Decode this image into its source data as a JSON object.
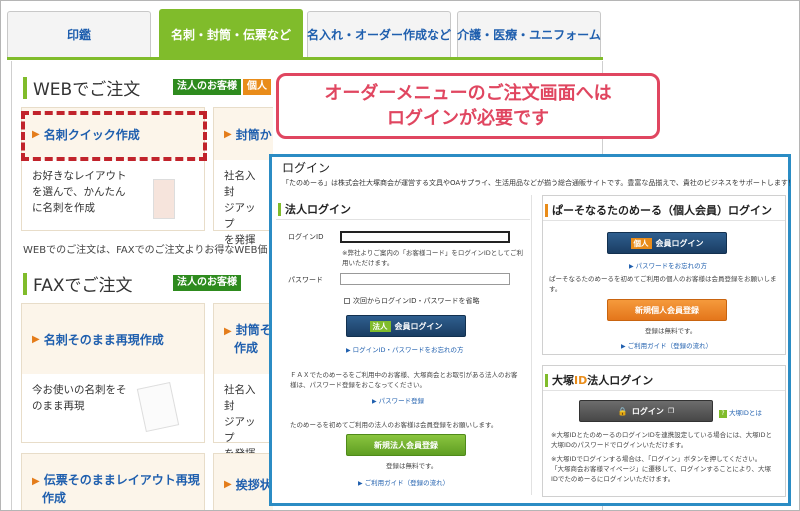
{
  "tabs": [
    {
      "label": "印鑑"
    },
    {
      "label": "名刺・封筒・伝票など"
    },
    {
      "label": "名入れ・オーダー作成など"
    },
    {
      "label": "介護・医療・ユニフォーム"
    }
  ],
  "web_section": {
    "title": "WEBでご注文",
    "badge_corp": "法人のお客様",
    "badge_indiv": "個人",
    "cards": [
      {
        "title": "名刺クイック作成",
        "desc_lines": [
          "お好きなレイアウト",
          "を選んで、かんたん",
          "に名刺を作成"
        ]
      },
      {
        "title": "封筒か",
        "desc_lines": [
          "社名入封",
          "ジアップ",
          "を発揮"
        ]
      }
    ],
    "note": "WEBでのご注文は、FAXでのご注文よりお得なWEB価"
  },
  "fax_section": {
    "title": "FAXでご注文",
    "badge_corp": "法人のお客様",
    "cards": [
      {
        "title": "名刺そのまま再現作成",
        "desc_lines": [
          "今お使いの名刺をそ",
          "のまま再現"
        ]
      },
      {
        "title_lines": [
          "封筒そ",
          "作成"
        ],
        "desc_lines": [
          "社名入封",
          "ジアップ",
          "を発揮"
        ]
      },
      {
        "title_lines": [
          "伝票そのままレイアウト再現",
          "作成"
        ]
      },
      {
        "title": "挨拶状"
      }
    ]
  },
  "callout": {
    "line1": "オーダーメニューのご注文画面へは",
    "line2": "ログインが必要です"
  },
  "login": {
    "title": "ログイン",
    "intro": "「たのめーる」は株式会社大塚商会が運営する文具やOAサプライ、生活用品などが揃う総合通販サイトです。豊富な品揃えで、貴社のビジネスをサポートします！",
    "corporate": {
      "heading": "法人ログイン",
      "id_label": "ログインID",
      "id_note_lines": [
        "※弊社よりご案内の「お客様コード」をログインIDとしてご利",
        "用いただけます。"
      ],
      "pw_label": "パスワード",
      "remember_label": "次回からログインID・パスワードを省略",
      "login_tag": "法人",
      "login_label": "会員ログイン",
      "forgot_link": "ログインID・パスワードをお忘れの方",
      "fax_note_lines": [
        "ＦＡＸでたのめーるをご利用中のお客様、大塚商会とお取引がある法人のお客",
        "様は、パスワード登録をおこなってください。"
      ],
      "pw_register_link": "パスワード登録",
      "first_note": "たのめーるを初めてご利用の法人のお客様は会員登録をお願いします。",
      "register_label": "新規法人会員登録",
      "free_note": "登録は無料です。",
      "guide_link": "ご利用ガイド（登録の流れ）"
    },
    "personal": {
      "heading": "ぱーそなるたのめーる（個人会員）ログイン",
      "login_tag": "個人",
      "login_label": "会員ログイン",
      "forgot_link": "パスワードをお忘れの方",
      "first_note": "ぱーそなるたのめーるを初めてご利用の個人のお客様は会員登録をお願いします。",
      "register_label": "新規個人会員登録",
      "free_note": "登録は無料です。",
      "guide_link": "ご利用ガイド（登録の流れ）"
    },
    "otsuka": {
      "heading_prefix": "大塚",
      "heading_id": "ID",
      "heading_suffix": " 法人ログイン",
      "login_label": "ログイン",
      "help_link": "大塚IDとは",
      "note1_lines": [
        "※大塚IDとたのめーるのログインIDを連携設定している場合には、大塚IDと",
        "大塚IDのパスワードでログインいただけます。"
      ],
      "note2_lines": [
        "※大塚IDでログインする場合は、「ログイン」ボタンを押してください。",
        "「大塚商会お客様マイページ」に遷移して、ログインすることにより、大塚",
        "IDでたのめーるにログインいただけます。"
      ]
    }
  },
  "colors": {
    "accent_green": "#80bc2b",
    "link_blue": "#1f5fae",
    "callout_red": "#e04660",
    "dashed_red": "#c1232b",
    "login_border": "#2b8cc4",
    "navy_button": "#1a3d63",
    "orange": "#e98c1a"
  }
}
